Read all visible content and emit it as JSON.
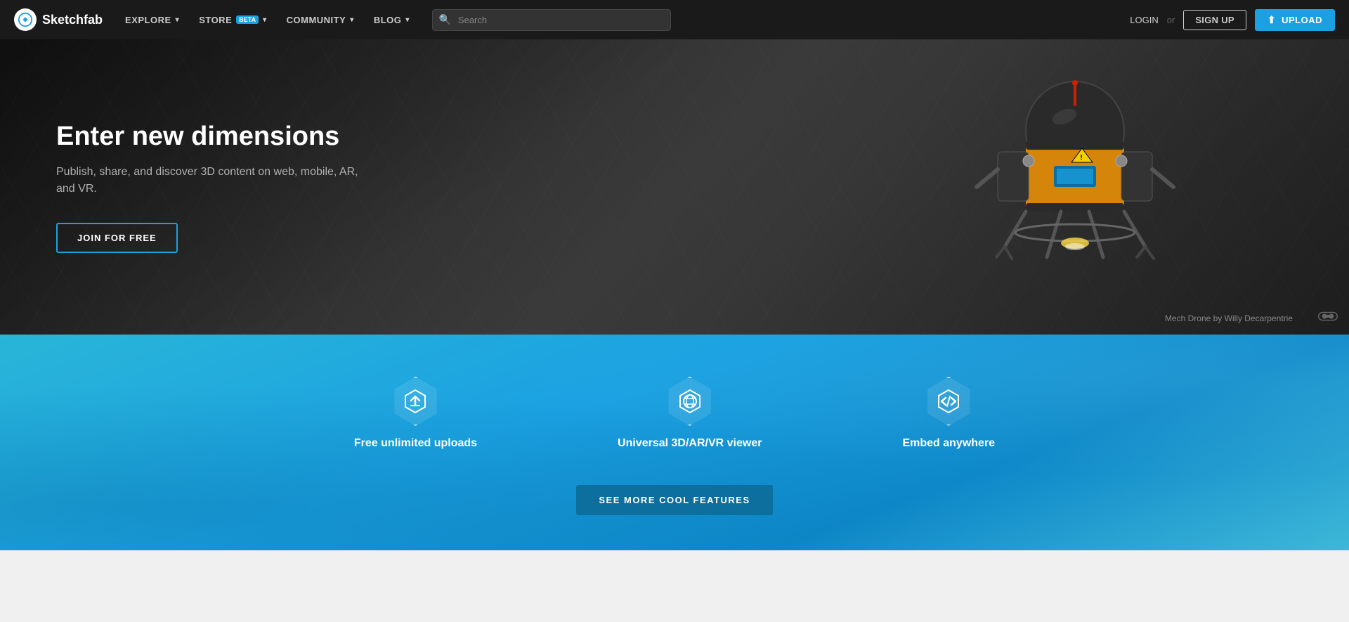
{
  "navbar": {
    "brand_name": "Sketchfab",
    "nav_items": [
      {
        "label": "EXPLORE",
        "has_dropdown": true
      },
      {
        "label": "STORE",
        "has_beta": true,
        "has_dropdown": true
      },
      {
        "label": "COMMUNITY",
        "has_dropdown": true
      },
      {
        "label": "BLOG",
        "has_dropdown": true
      }
    ],
    "search_placeholder": "Search",
    "login_label": "LOGIN",
    "or_label": "or",
    "signup_label": "SIGN UP",
    "upload_label": "UPLOAD"
  },
  "hero": {
    "title": "Enter new dimensions",
    "subtitle": "Publish, share, and discover 3D content on web, mobile, AR, and VR.",
    "cta_label": "JOIN FOR FREE",
    "credit_text": "Mech Drone by Willy Decarpentrie"
  },
  "features": {
    "items": [
      {
        "label": "Free unlimited uploads",
        "icon": "upload"
      },
      {
        "label": "Universal 3D/AR/VR viewer",
        "icon": "globe"
      },
      {
        "label": "Embed anywhere",
        "icon": "code"
      }
    ],
    "see_more_label": "SEE MORE COOL FEATURES"
  }
}
